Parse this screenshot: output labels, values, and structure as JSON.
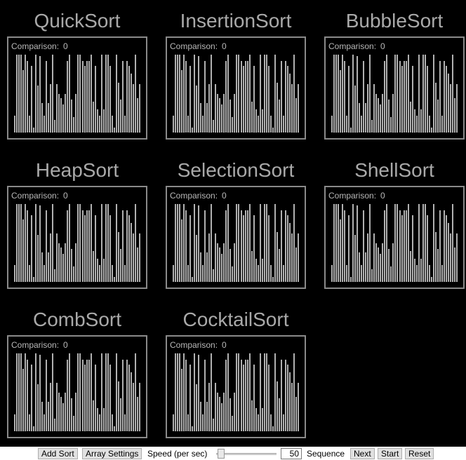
{
  "comparison_label": "Comparison:",
  "panels": [
    {
      "name": "QuickSort",
      "comparisons": "0"
    },
    {
      "name": "InsertionSort",
      "comparisons": "0"
    },
    {
      "name": "BubbleSort",
      "comparisons": "0"
    },
    {
      "name": "HeapSort",
      "comparisons": "0"
    },
    {
      "name": "SelectionSort",
      "comparisons": "0"
    },
    {
      "name": "ShellSort",
      "comparisons": "0"
    },
    {
      "name": "CombSort",
      "comparisons": "0"
    },
    {
      "name": "CocktailSort",
      "comparisons": "0"
    }
  ],
  "array_values": [
    22,
    100,
    100,
    100,
    80,
    100,
    92,
    22,
    86,
    6,
    100,
    60,
    98,
    38,
    22,
    92,
    38,
    62,
    100,
    16,
    62,
    50,
    44,
    36,
    50,
    92,
    100,
    42,
    20,
    50,
    100,
    100,
    92,
    86,
    92,
    92,
    100,
    40,
    86,
    30,
    22,
    100,
    30,
    100,
    100,
    86,
    22,
    6,
    100,
    64,
    42,
    92,
    22,
    92,
    86,
    76,
    62,
    100,
    44,
    62
  ],
  "toolbar": {
    "add_sort": "Add Sort",
    "array_settings": "Array Settings",
    "speed_label": "Speed (per sec)",
    "speed_value": "50",
    "speed_slider_level": 0.05,
    "sequence_label": "Sequence",
    "next": "Next",
    "start": "Start",
    "reset": "Reset"
  }
}
